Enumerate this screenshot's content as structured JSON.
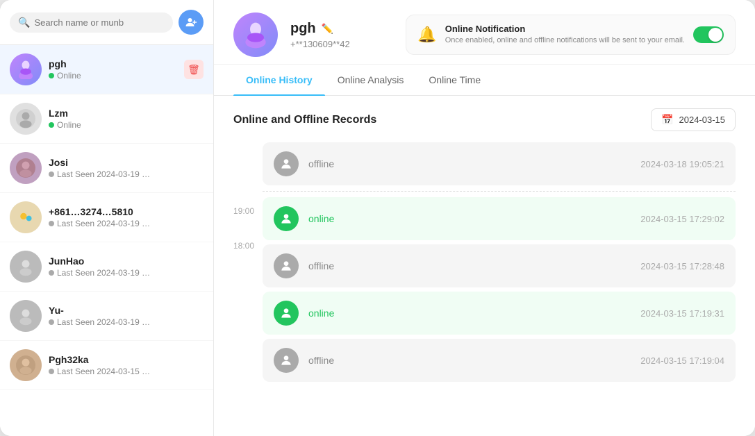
{
  "search": {
    "placeholder": "Search name or munb"
  },
  "sidebar": {
    "contacts": [
      {
        "id": "pgh",
        "name": "pgh",
        "status": "Online",
        "status_type": "online",
        "avatar_type": "pgh",
        "active": true,
        "show_delete": true
      },
      {
        "id": "lzm",
        "name": "Lzm",
        "status": "Online",
        "status_type": "online",
        "avatar_type": "lzm",
        "active": false,
        "show_delete": false
      },
      {
        "id": "josi",
        "name": "Josi",
        "status": "Last Seen 2024-03-19 …",
        "status_type": "offline",
        "avatar_type": "josi",
        "active": false,
        "show_delete": false
      },
      {
        "id": "num",
        "name": "+861…3274…5810",
        "status": "Last Seen 2024-03-19 …",
        "status_type": "offline",
        "avatar_type": "num",
        "active": false,
        "show_delete": false
      },
      {
        "id": "junhao",
        "name": "JunHao",
        "status": "Last Seen 2024-03-19 …",
        "status_type": "offline",
        "avatar_type": "junhao",
        "active": false,
        "show_delete": false
      },
      {
        "id": "yu",
        "name": "Yu-",
        "status": "Last Seen 2024-03-19 …",
        "status_type": "offline",
        "avatar_type": "yu",
        "active": false,
        "show_delete": false
      },
      {
        "id": "pgh32ka",
        "name": "Pgh32ka",
        "status": "Last Seen 2024-03-15 …",
        "status_type": "offline",
        "avatar_type": "pgh32ka",
        "active": false,
        "show_delete": false
      }
    ]
  },
  "profile": {
    "name": "pgh",
    "phone": "+**130609**42"
  },
  "notification": {
    "title": "Online Notification",
    "description": "Once enabled, online and offline notifications will be sent to your email.",
    "enabled": true
  },
  "tabs": [
    {
      "id": "history",
      "label": "Online History",
      "active": true
    },
    {
      "id": "analysis",
      "label": "Online Analysis",
      "active": false
    },
    {
      "id": "time",
      "label": "Online Time",
      "active": false
    }
  ],
  "records_section": {
    "title": "Online and Offline Records",
    "date": "2024-03-15",
    "time_labels": [
      "19:00",
      "18:00"
    ],
    "records": [
      {
        "type": "offline",
        "status_label": "offline",
        "time": "2024-03-18 19:05:21"
      },
      {
        "type": "online",
        "status_label": "online",
        "time": "2024-03-15 17:29:02"
      },
      {
        "type": "offline",
        "status_label": "offline",
        "time": "2024-03-15 17:28:48"
      },
      {
        "type": "online",
        "status_label": "online",
        "time": "2024-03-15 17:19:31"
      },
      {
        "type": "offline",
        "status_label": "offline",
        "time": "2024-03-15 17:19:04"
      }
    ]
  }
}
